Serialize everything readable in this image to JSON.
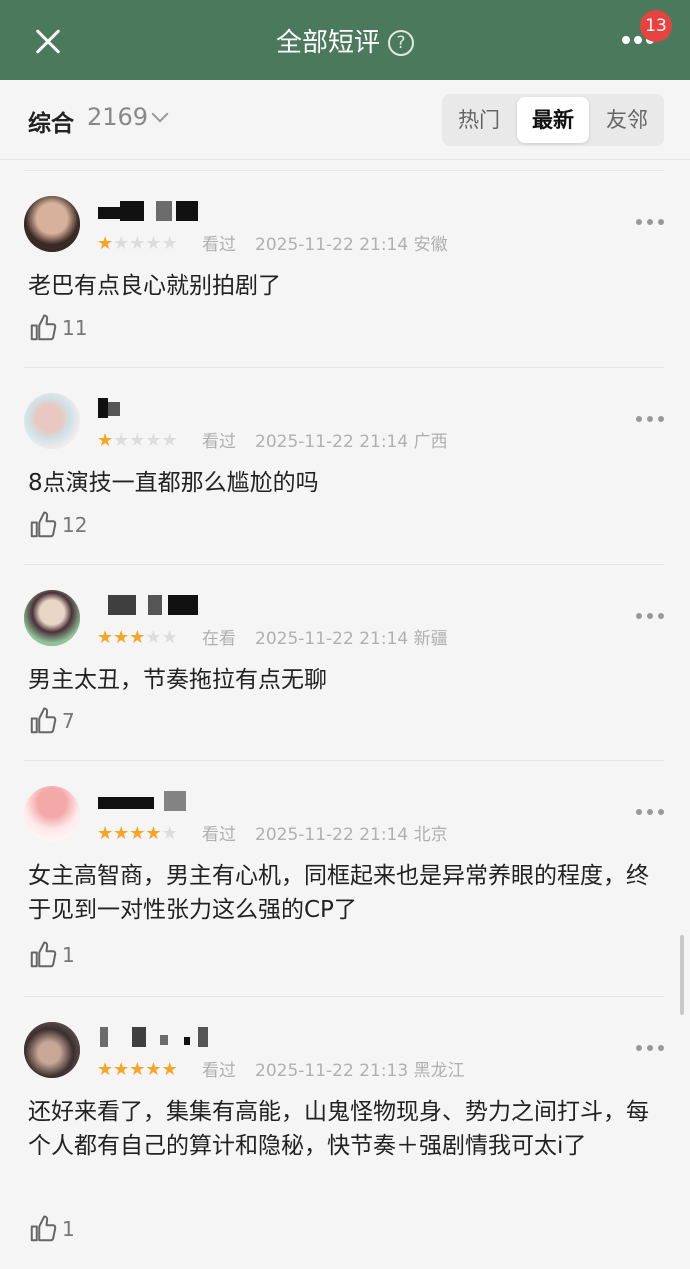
{
  "header": {
    "title": "全部短评",
    "help_icon": "question-circle-icon",
    "badge_count": "13",
    "colors": {
      "bar": "#4a7a5b",
      "badge": "#e64340"
    }
  },
  "filter": {
    "sort_label": "综合",
    "count": "2169",
    "tabs": [
      "热门",
      "最新",
      "友邻"
    ],
    "active_tab": "最新"
  },
  "comments": [
    {
      "rating": 1,
      "status": "看过",
      "time": "2025-11-22 21:14",
      "location": "安徽",
      "text": "老巴有点良心就别拍剧了",
      "likes": "11"
    },
    {
      "rating": 1,
      "status": "看过",
      "time": "2025-11-22 21:14",
      "location": "广西",
      "text": "8点演技一直都那么尴尬的吗",
      "likes": "12"
    },
    {
      "rating": 3,
      "status": "在看",
      "time": "2025-11-22 21:14",
      "location": "新疆",
      "text": "男主太丑，节奏拖拉有点无聊",
      "likes": "7"
    },
    {
      "rating": 4,
      "status": "看过",
      "time": "2025-11-22 21:14",
      "location": "北京",
      "text": "女主高智商，男主有心机，同框起来也是异常养眼的程度，终于见到一对性张力这么强的CP了",
      "likes": "1"
    },
    {
      "rating": 5,
      "status": "看过",
      "time": "2025-11-22 21:13",
      "location": "黑龙江",
      "text": "还好来看了，集集有高能，山鬼怪物现身、势力之间打斗，每个人都有自己的算计和隐秘，快节奏＋强剧情我可太i了",
      "likes": "1"
    }
  ],
  "colors": {
    "star_on": "#f5a623",
    "star_off": "#dddddd"
  }
}
